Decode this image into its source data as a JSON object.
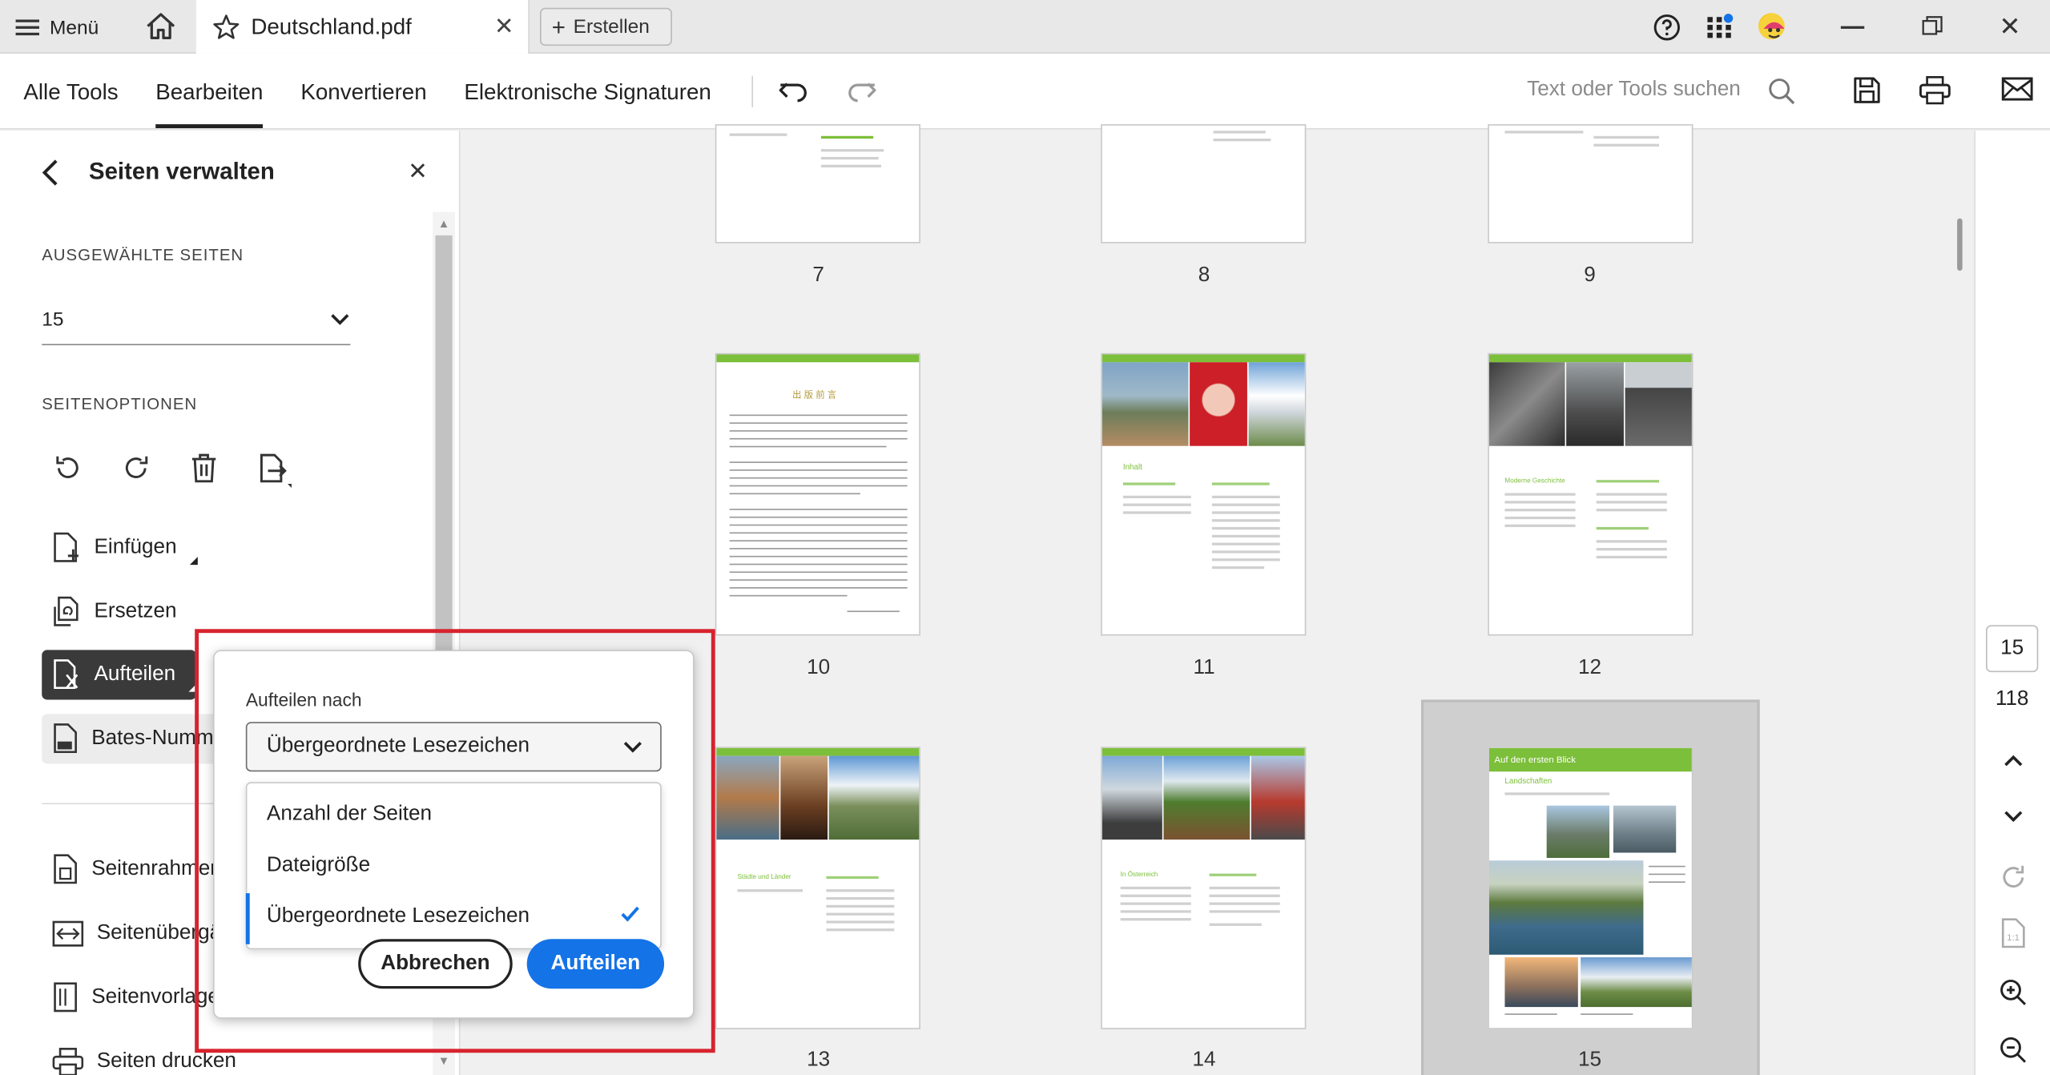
{
  "titlebar": {
    "menu_label": "Menü",
    "tab_title": "Deutschland.pdf",
    "create_label": "Erstellen"
  },
  "toolbar": {
    "tabs": [
      "Alle Tools",
      "Bearbeiten",
      "Konvertieren",
      "Elektronische Signaturen"
    ],
    "active_tab": "Bearbeiten",
    "search_placeholder": "Text oder Tools suchen"
  },
  "panel": {
    "title": "Seiten verwalten",
    "selected_label": "AUSGEWÄHLTE SEITEN",
    "selected_value": "15",
    "options_label": "SEITENOPTIONEN",
    "items": [
      {
        "label": "Einfügen"
      },
      {
        "label": "Ersetzen"
      },
      {
        "label": "Aufteilen"
      },
      {
        "label": "Bates-Numm"
      },
      {
        "label": "Seitenrahmen"
      },
      {
        "label": "Seitenübergä"
      },
      {
        "label": "Seitenvorlage"
      },
      {
        "label": "Seiten drucken"
      }
    ]
  },
  "pages": {
    "labels": [
      "7",
      "8",
      "9",
      "10",
      "11",
      "12",
      "13",
      "14",
      "15"
    ],
    "selected": "15",
    "thumb_text": {
      "p11_title": "Inhalt",
      "p12_title": "Moderne Geschichte",
      "p15_title": "Auf den ersten Blick",
      "p15_sub": "Landschaften",
      "p10_title": "出 版 前 言",
      "p13_title": "Städte und Länder",
      "p14_title": "In Österreich"
    }
  },
  "nav": {
    "current_page": "15",
    "total_pages": "118"
  },
  "popup": {
    "label": "Aufteilen nach",
    "selected": "Übergeordnete Lesezeichen",
    "options": [
      "Anzahl der Seiten",
      "Dateigröße",
      "Übergeordnete Lesezeichen"
    ],
    "cancel": "Abbrechen",
    "confirm": "Aufteilen"
  },
  "colors": {
    "accent": "#1473e6",
    "highlight_outline": "#d7232e",
    "page_green": "#7cbf3a"
  }
}
